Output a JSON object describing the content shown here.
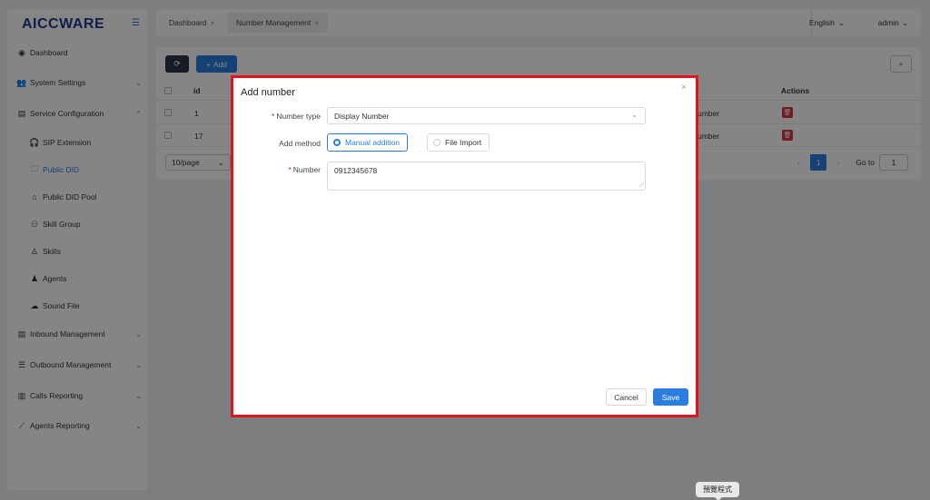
{
  "app": {
    "logo": "AICCWARE"
  },
  "sidebar": {
    "items": [
      {
        "label": "Dashboard",
        "icon": "dashboard-icon"
      },
      {
        "label": "System Settings",
        "icon": "users-icon"
      },
      {
        "label": "Service Configuration",
        "icon": "list-icon"
      },
      {
        "label": "SIP Extension",
        "icon": "headset-icon"
      },
      {
        "label": "Public DID",
        "icon": "folder-icon"
      },
      {
        "label": "Public DID Pool",
        "icon": "home-icon"
      },
      {
        "label": "Skill Group",
        "icon": "user-group-icon"
      },
      {
        "label": "Skills",
        "icon": "user-icon"
      },
      {
        "label": "Agents",
        "icon": "agent-icon"
      },
      {
        "label": "Sound File",
        "icon": "cloud-upload-icon"
      },
      {
        "label": "Inbound Management",
        "icon": "inbox-icon"
      },
      {
        "label": "Outbound Management",
        "icon": "list-icon"
      },
      {
        "label": "Calls Reporting",
        "icon": "bar-chart-icon"
      },
      {
        "label": "Agents Reporting",
        "icon": "line-chart-icon"
      }
    ]
  },
  "topbar": {
    "tabs": [
      {
        "label": "Dashboard",
        "close": "×"
      },
      {
        "label": "Number Management",
        "close": "×"
      }
    ],
    "language": "English",
    "user": "admin"
  },
  "toolbar": {
    "add_label": "Add"
  },
  "table": {
    "headers": {
      "id": "id",
      "actions": "Actions"
    },
    "rows": [
      {
        "id": "1",
        "type": "umber"
      },
      {
        "id": "17",
        "type": "umber"
      }
    ],
    "page_size": "10/page",
    "current_page": "1",
    "goto_label": "Go to",
    "goto_value": "1"
  },
  "modal": {
    "title": "Add number",
    "close": "×",
    "number_type_label": "Number type",
    "number_type_value": "Display Number",
    "add_method_label": "Add method",
    "method_manual": "Manual addition",
    "method_file": "File Import",
    "number_label": "Number",
    "number_value": "0912345678",
    "cancel_label": "Cancel",
    "save_label": "Save"
  },
  "tooltip": {
    "text": "預覽程式"
  },
  "colors": {
    "accent": "#2a7de1",
    "danger": "#d9363e",
    "highlight_border": "#e0141c",
    "logo": "#1f3b8f"
  }
}
